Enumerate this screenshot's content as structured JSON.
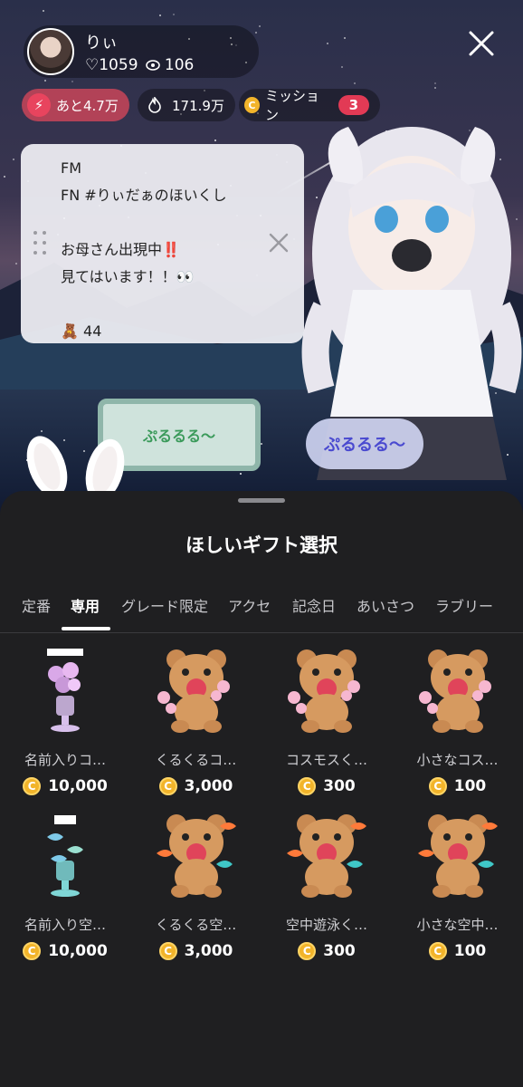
{
  "host": {
    "name": "りぃ",
    "likes": "♡1059",
    "viewers": "106"
  },
  "chips": {
    "rank": "あと4.7万",
    "fire": "171.9万",
    "mission_label": "ミッション",
    "mission_count": "3"
  },
  "scene": {
    "sign_text": "ぷるるる〜",
    "bubble_text": "ぷるるる〜"
  },
  "comment": {
    "line1": "FM",
    "line2": "FN  #りぃだぁのほいくし",
    "line3": "お母さん出現中‼️",
    "line4": "見てはいます！！👀",
    "bear_count": "44"
  },
  "sheet": {
    "title": "ほしいギフト選択",
    "tabs": [
      "定番",
      "専用",
      "グレード限定",
      "アクセ",
      "記念日",
      "あいさつ",
      "ラブリー"
    ],
    "active_tab": "専用"
  },
  "gifts": [
    {
      "name": "名前入りコ…",
      "price": "10,000",
      "icon": "flower-vase-icon"
    },
    {
      "name": "くるくるコ…",
      "price": "3,000",
      "icon": "bear-flowers-icon"
    },
    {
      "name": "コスモスく…",
      "price": "300",
      "icon": "bear-flowers-icon"
    },
    {
      "name": "小さなコス…",
      "price": "100",
      "icon": "bear-flowers-icon"
    },
    {
      "name": "名前入り空…",
      "price": "10,000",
      "icon": "fish-stand-icon"
    },
    {
      "name": "くるくる空…",
      "price": "3,000",
      "icon": "bear-fish-icon"
    },
    {
      "name": "空中遊泳く…",
      "price": "300",
      "icon": "bear-fish-icon"
    },
    {
      "name": "小さな空中…",
      "price": "100",
      "icon": "bear-fish-icon"
    }
  ],
  "colors": {
    "sheet_bg": "#1f1f21",
    "coin": "#f2b42a",
    "mission_badge": "#e23a55"
  }
}
